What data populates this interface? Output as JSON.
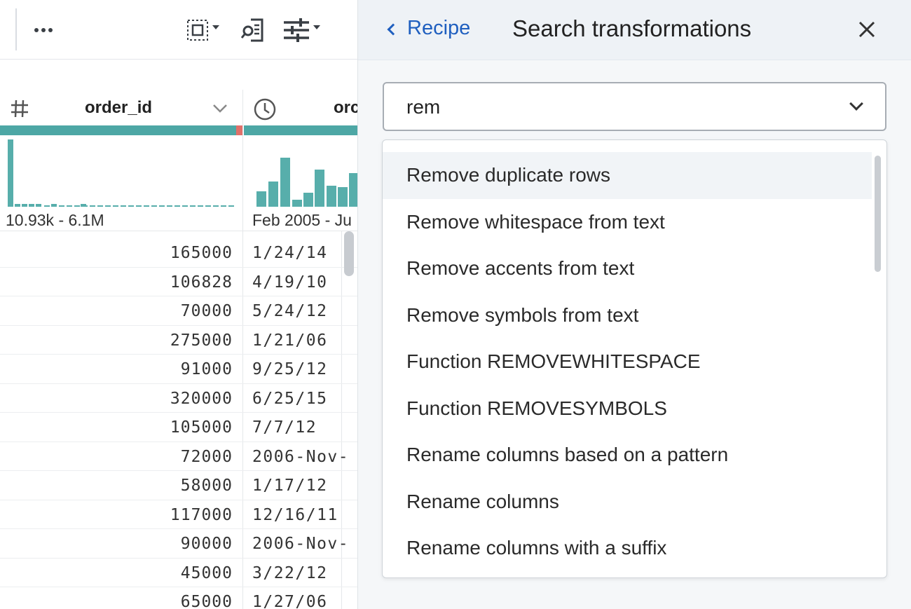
{
  "toolbar": {
    "more_icon": "ellipsis-icon",
    "select_icon": "select-columns-icon",
    "schema_icon": "document-search-icon",
    "filter_icon": "sliders-icon"
  },
  "grid": {
    "columns": [
      {
        "name": "order_id",
        "type_icon": "hash-icon",
        "range": "10.93k - 6.1M"
      },
      {
        "name": "orc",
        "type_icon": "clock-icon",
        "range": "Feb 2005 - Ju"
      }
    ],
    "rows": [
      {
        "order_id": "165000",
        "date": "1/24/14"
      },
      {
        "order_id": "106828",
        "date": "4/19/10"
      },
      {
        "order_id": "70000",
        "date": "5/24/12"
      },
      {
        "order_id": "275000",
        "date": "1/21/06"
      },
      {
        "order_id": "91000",
        "date": "9/25/12"
      },
      {
        "order_id": "320000",
        "date": "6/25/15"
      },
      {
        "order_id": "105000",
        "date": "7/7/12"
      },
      {
        "order_id": "72000",
        "date": "2006-Nov-"
      },
      {
        "order_id": "58000",
        "date": "1/17/12"
      },
      {
        "order_id": "117000",
        "date": "12/16/11"
      },
      {
        "order_id": "90000",
        "date": "2006-Nov-"
      },
      {
        "order_id": "45000",
        "date": "3/22/12"
      },
      {
        "order_id": "65000",
        "date": "1/27/06"
      }
    ],
    "colors": {
      "valid": "#4da7a5",
      "mismatch": "#e0706a",
      "histogram": "#57aeab"
    }
  },
  "panel": {
    "back_label": "Recipe",
    "title": "Search transformations",
    "close_icon": "close-icon",
    "search": {
      "value": "rem",
      "placeholder": ""
    },
    "options": [
      "Remove duplicate rows",
      "Remove whitespace from text",
      "Remove accents from text",
      "Remove symbols from text",
      "Function REMOVEWHITESPACE",
      "Function REMOVESYMBOLS",
      "Rename columns based on a pattern",
      "Rename columns",
      "Rename columns with a suffix"
    ],
    "active_option_index": 0,
    "accent_color": "#1f5fbf"
  }
}
